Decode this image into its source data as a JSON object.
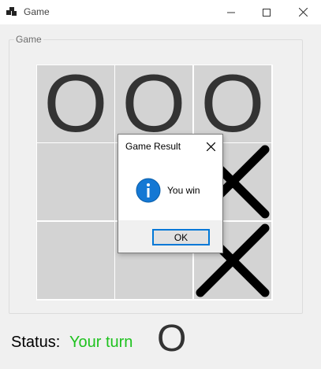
{
  "window": {
    "title": "Game",
    "icon": "app-window-icon",
    "controls": [
      "minimize-icon",
      "maximize-icon",
      "close-icon"
    ]
  },
  "group": {
    "label": "Game"
  },
  "board": {
    "cells": [
      {
        "value": "O"
      },
      {
        "value": "O"
      },
      {
        "value": "O"
      },
      {
        "value": ""
      },
      {
        "value": ""
      },
      {
        "value": "X"
      },
      {
        "value": ""
      },
      {
        "value": ""
      },
      {
        "value": "X"
      }
    ]
  },
  "dialog": {
    "title": "Game Result",
    "message": "You win",
    "icon": "info-icon",
    "ok_label": "OK"
  },
  "status": {
    "label": "Status:",
    "value": "Your turn",
    "symbol": "O"
  },
  "colors": {
    "cell_background": "#d3d3d3",
    "mark_color": "#333333",
    "status_value": "#1ec21e",
    "accent_button_border": "#0078d7",
    "info_icon": "#1478d4"
  }
}
